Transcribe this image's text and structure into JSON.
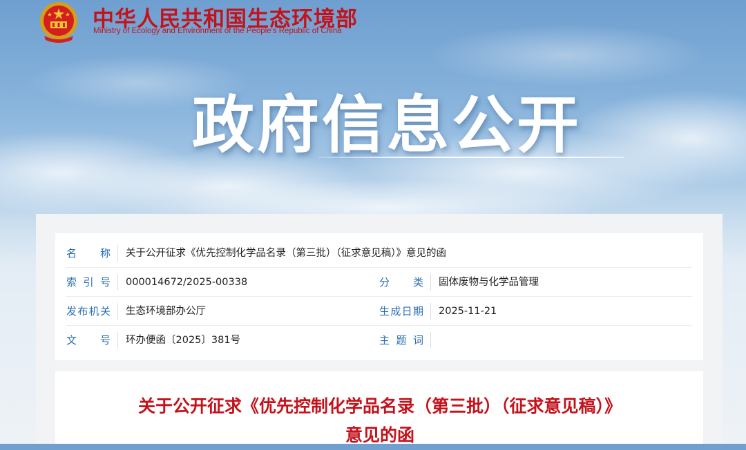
{
  "site": {
    "name_cn": "中华人民共和国生态环境部",
    "name_en": "Ministry of Ecology and Environment of the People's Republic of China"
  },
  "banner": {
    "title": "政府信息公开"
  },
  "info": {
    "name_label": "名称",
    "name_value": "关于公开征求《优先控制化学品名录（第三批）（征求意见稿）》意见的函",
    "index_label": "索引号",
    "index_value": "000014672/2025-00338",
    "category_label": "分类",
    "category_value": "固体废物与化学品管理",
    "issuer_label": "发布机关",
    "issuer_value": "生态环境部办公厅",
    "date_label": "生成日期",
    "date_value": "2025-11-21",
    "doc_no_label": "文号",
    "doc_no_value": "环办便函〔2025〕381号",
    "subject_label": "主题词",
    "subject_value": ""
  },
  "document": {
    "title": "关于公开征求《优先控制化学品名录（第三批）（征求意见稿）》意见的函"
  },
  "colors": {
    "brand_red": "#c4121b",
    "label_blue": "#2a6db3"
  }
}
